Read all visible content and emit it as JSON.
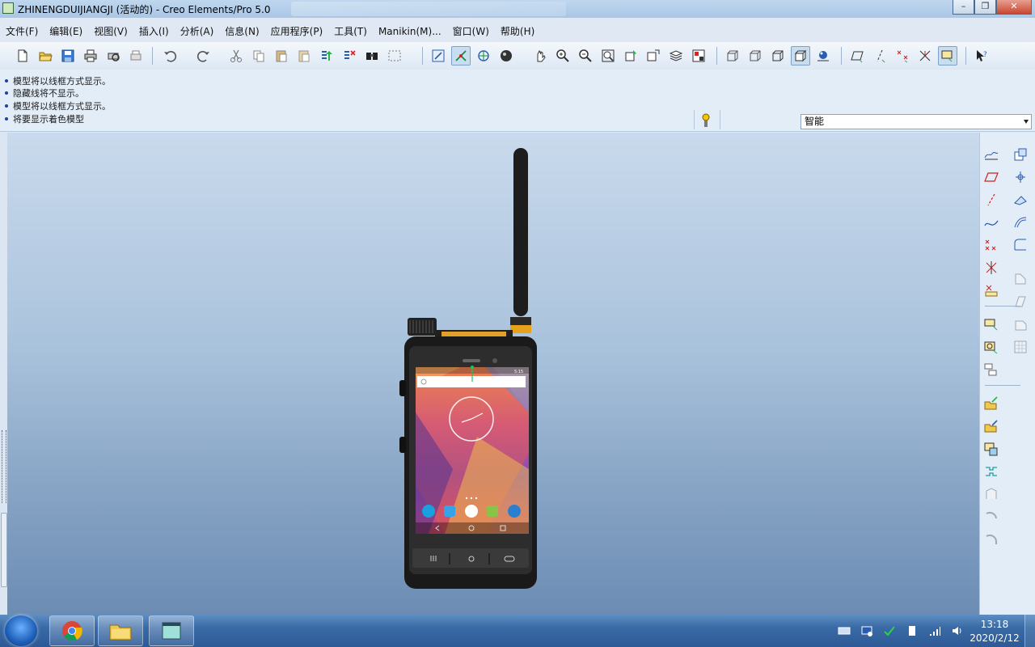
{
  "window": {
    "title": "ZHINENGDUIJIANGJI (活动的) - Creo Elements/Pro 5.0",
    "minimize_symbol": "–",
    "restore_symbol": "❐",
    "close_symbol": "✕"
  },
  "menu": {
    "items": [
      "文件(F)",
      "编辑(E)",
      "视图(V)",
      "插入(I)",
      "分析(A)",
      "信息(N)",
      "应用程序(P)",
      "工具(T)",
      "Manikin(M)...",
      "窗口(W)",
      "帮助(H)"
    ]
  },
  "toolbar": {
    "icons": [
      "new-icon",
      "open-icon",
      "save-icon",
      "print-icon",
      "print-preview-icon",
      "quick-print-icon",
      "undo-icon",
      "redo-icon",
      "cut-icon",
      "copy-icon",
      "paste-icon",
      "paste-special-icon",
      "regenerate-icon",
      "regenerate-manager-icon",
      "find-icon",
      "selection-box-icon",
      "repaint-icon",
      "spin-center-icon",
      "orient-mode-icon",
      "shading-icon",
      "pan-icon",
      "zoom-in-icon",
      "zoom-out-icon",
      "refit-icon",
      "reorient-icon",
      "saved-views-icon",
      "layers-icon",
      "view-manager-icon",
      "wireframe-icon",
      "hidden-line-icon",
      "no-hidden-icon",
      "shaded-icon",
      "enhanced-realism-icon",
      "datum-planes-icon",
      "datum-axes-icon",
      "datum-points-icon",
      "coordinate-systems-icon",
      "annotation-icon",
      "context-help-icon"
    ]
  },
  "messages": [
    "模型将以线框方式显示。",
    "隐藏线将不显示。",
    "模型将以线框方式显示。",
    "将要显示着色模型"
  ],
  "filter": {
    "selected": "智能"
  },
  "rightpanel": {
    "icons": [
      "sketch-icon",
      "plane-icon",
      "axis-icon",
      "curve-icon",
      "point-icon",
      "point-offset-icon",
      "analysis-point-icon",
      "datum-rotate-icon",
      "datum-box-icon",
      "datum-chain-icon",
      "insert-feature-icon",
      "insert-multi-icon",
      "merge-icon",
      "trim-icon",
      "offset-icon",
      "round-icon",
      "chamfer-icon",
      "draft-icon",
      "extrude-icon",
      "revolve-icon",
      "sweep-icon",
      "blend-icon",
      "shell-icon",
      "rib-icon",
      "hole-icon",
      "pattern-icon",
      "mirror-icon",
      "project-icon"
    ]
  },
  "phone_screen": {
    "time": "5:15"
  },
  "taskbar": {
    "apps": [
      "windows-start-icon",
      "chrome-icon",
      "file-explorer-icon",
      "creo-app-icon"
    ],
    "clock_time": "13:18",
    "clock_date": "2020/2/12"
  },
  "colors": {
    "menu_accent": "#c9ddf1",
    "graphics_top": "#c9daec",
    "graphics_bottom": "#6c8cb4",
    "antenna_band": "#e8a11a"
  }
}
